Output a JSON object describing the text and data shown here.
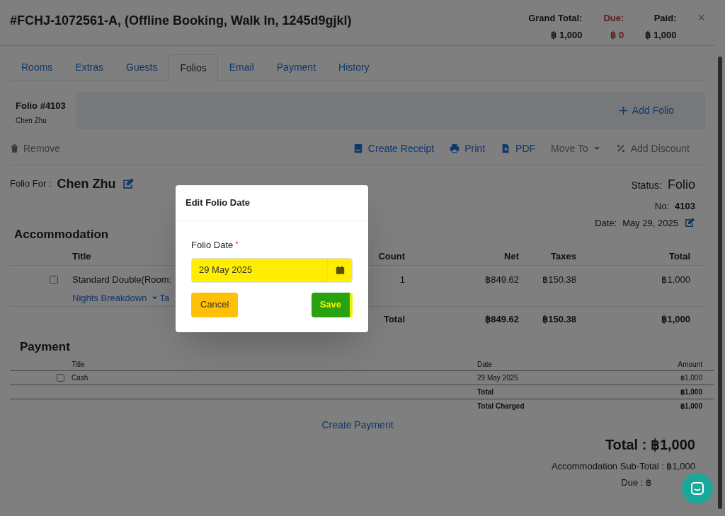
{
  "header": {
    "title": "#FCHJ-1072561-A, (Offline Booking, Walk In, 1245d9gjkl)",
    "totals": [
      {
        "label": "Grand Total:",
        "value": "฿ 1,000",
        "kind": "normal"
      },
      {
        "label": "Due:",
        "value": "฿ 0",
        "kind": "due"
      },
      {
        "label": "Paid:",
        "value": "฿ 1,000",
        "kind": "normal"
      }
    ],
    "close": "×"
  },
  "tabs": [
    {
      "label": "Rooms",
      "selected": false
    },
    {
      "label": "Extras",
      "selected": false
    },
    {
      "label": "Guests",
      "selected": false
    },
    {
      "label": "Folios",
      "selected": true
    },
    {
      "label": "Email",
      "selected": false
    },
    {
      "label": "Payment",
      "selected": false
    },
    {
      "label": "History",
      "selected": false
    }
  ],
  "folio_card": {
    "title": "Folio #4103",
    "guest": "Chen Zhu",
    "add_button": "Add Folio"
  },
  "toolbar": {
    "remove": "Remove",
    "actions": [
      {
        "label": "Create Receipt",
        "kind": "receipt",
        "disabled": false
      },
      {
        "label": "Print",
        "kind": "print",
        "disabled": false
      },
      {
        "label": "PDF",
        "kind": "pdf",
        "disabled": false
      },
      {
        "label": "Move To",
        "kind": "dropdown",
        "disabled": true
      },
      {
        "label": "Add Discount",
        "kind": "discount",
        "disabled": true
      }
    ]
  },
  "folio_for": {
    "label": "Folio For :",
    "name": "Chen Zhu"
  },
  "info": {
    "status_label": "Status:",
    "status": "Folio",
    "no_label": "No:",
    "no": "4103",
    "date_label": "Date:",
    "date": "May 29, 2025"
  },
  "accommodation": {
    "heading": "Accommodation",
    "columns": [
      "Title",
      "Count",
      "Net",
      "Taxes",
      "Total"
    ],
    "rows": [
      {
        "title": "Standard Double(Room:",
        "checked": false,
        "link": "Nights Breakdown",
        "cut_link": "Ta",
        "count": "1",
        "net": "฿849.62",
        "taxes": "฿150.38",
        "total": "฿1,000"
      }
    ],
    "total_row": {
      "label": "Total",
      "net": "฿849.62",
      "taxes": "฿150.38",
      "total": "฿1,000"
    }
  },
  "payment": {
    "heading": "Payment",
    "columns": [
      "Title",
      "Date",
      "Amount"
    ],
    "rows": [
      {
        "title": "Cash",
        "checked": false,
        "date": "29 May 2025",
        "amount": "฿1,000"
      }
    ],
    "summary": [
      {
        "label": "Total",
        "value": "฿1,000"
      },
      {
        "label": "Total Charged",
        "value": "฿1,000"
      }
    ],
    "create_link": "Create Payment"
  },
  "summary": {
    "total": "Total : ฿1,000",
    "subtotal": "Accommodation Sub-Total : ฿1,000",
    "due": "Due : ฿"
  },
  "modal": {
    "title": "Edit Folio Date",
    "field_label": "Folio Date",
    "required": "*",
    "value": "29 May 2025",
    "cancel": "Cancel",
    "save": "Save"
  }
}
